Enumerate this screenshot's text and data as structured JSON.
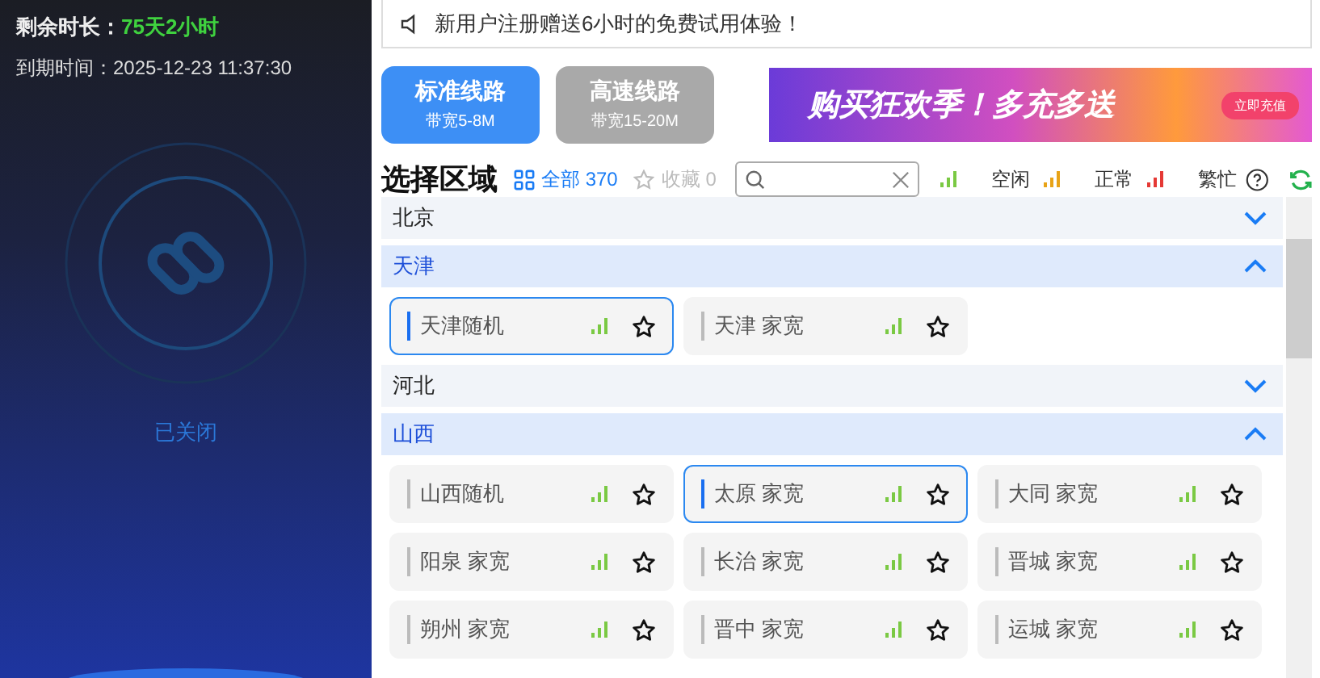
{
  "account": {
    "remaining_label": "剩余时长：",
    "remaining_value": "75天2小时",
    "expiry": "到期时间：2025-12-23 11:37:30"
  },
  "connection": {
    "status_text": "已关闭"
  },
  "notice": {
    "text": "新用户注册赠送6小时的免费试用体验！"
  },
  "routes": [
    {
      "title": "标准线路",
      "subtitle": "带宽5-8M",
      "selected": true
    },
    {
      "title": "高速线路",
      "subtitle": "带宽15-20M",
      "selected": false
    }
  ],
  "banner": {
    "headline": "购买狂欢季！多充多送",
    "button": "立即充值"
  },
  "region_header": {
    "title": "选择区域",
    "filters": [
      {
        "kind": "all",
        "label": "全部",
        "count": "370",
        "selected": true
      },
      {
        "kind": "favorites",
        "label": "收藏",
        "count": "0",
        "selected": false
      }
    ],
    "legend": [
      {
        "label": "空闲",
        "color": "#7ac943"
      },
      {
        "label": "正常",
        "color": "#e8a317"
      },
      {
        "label": "繁忙",
        "color": "#e53935"
      }
    ]
  },
  "groups": [
    {
      "name": "北京",
      "expanded": false
    },
    {
      "name": "天津",
      "expanded": true,
      "items": [
        {
          "name": "天津随机",
          "selected": true,
          "color": "#7ac943"
        },
        {
          "name": "天津 家宽",
          "selected": false,
          "color": "#7ac943"
        }
      ]
    },
    {
      "name": "河北",
      "expanded": false
    },
    {
      "name": "山西",
      "expanded": true,
      "items": [
        {
          "name": "山西随机",
          "selected": false,
          "color": "#7ac943"
        },
        {
          "name": "太原 家宽",
          "selected": true,
          "color": "#7ac943"
        },
        {
          "name": "大同 家宽",
          "selected": false,
          "color": "#7ac943"
        },
        {
          "name": "阳泉 家宽",
          "selected": false,
          "color": "#7ac943"
        },
        {
          "name": "长治 家宽",
          "selected": false,
          "color": "#7ac943"
        },
        {
          "name": "晋城 家宽",
          "selected": false,
          "color": "#7ac943"
        },
        {
          "name": "朔州 家宽",
          "selected": false,
          "color": "#7ac943"
        },
        {
          "name": "晋中 家宽",
          "selected": false,
          "color": "#7ac943"
        },
        {
          "name": "运城 家宽",
          "selected": false,
          "color": "#7ac943"
        }
      ]
    }
  ]
}
